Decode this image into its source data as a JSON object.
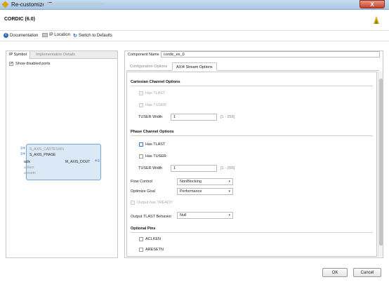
{
  "window": {
    "title": "Re-customize IP",
    "close_glyph": "X"
  },
  "header": {
    "title": "CORDIC (6.0)",
    "logo_icon": "xilinx-logo-icon"
  },
  "toolbar": {
    "documentation": "Documentation",
    "ip_location": "IP Location",
    "switch_defaults": "Switch to Defaults"
  },
  "left": {
    "tabs": [
      "IP Symbol",
      "Implementation Details"
    ],
    "show_disabled_ports": "Show disabled ports",
    "ports_left": [
      "S_AXIS_CARTESIAN",
      "S_AXIS_PHASE",
      "aclk",
      "aclken",
      "aresetn"
    ],
    "port_right": "M_AXIS_DOUT"
  },
  "right": {
    "component_name_label": "Component Name",
    "component_name_value": "cordic_ex_0",
    "tabs": [
      "Configuration Options",
      "AXI4 Stream Options"
    ],
    "cartesian": {
      "title": "Cartesian Channel Options",
      "has_tlast": "Has TLAST",
      "has_tuser": "Has TUSER",
      "tuser_width_label": "TUSER Width",
      "tuser_width_value": "1",
      "range": "[1 - 256]"
    },
    "phase": {
      "title": "Phase Channel Options",
      "has_tlast": "Has TLAST",
      "has_tuser": "Has TUSER",
      "tuser_width_label": "TUSER Width",
      "tuser_width_value": "1",
      "range": "[1 - 256]"
    },
    "flow_control_label": "Flow Control",
    "flow_control_value": "NonBlocking",
    "optimize_goal_label": "Optimize Goal",
    "optimize_goal_value": "Performance",
    "output_tready": "Output has TREADY",
    "output_tlast_label": "Output TLAST Behavior",
    "output_tlast_value": "Null",
    "optional_pins": {
      "title": "Optional Pins",
      "aclken": "ACLKEN",
      "aresetn": "ARESETN"
    }
  },
  "buttons": {
    "ok": "OK",
    "cancel": "Cancel"
  }
}
